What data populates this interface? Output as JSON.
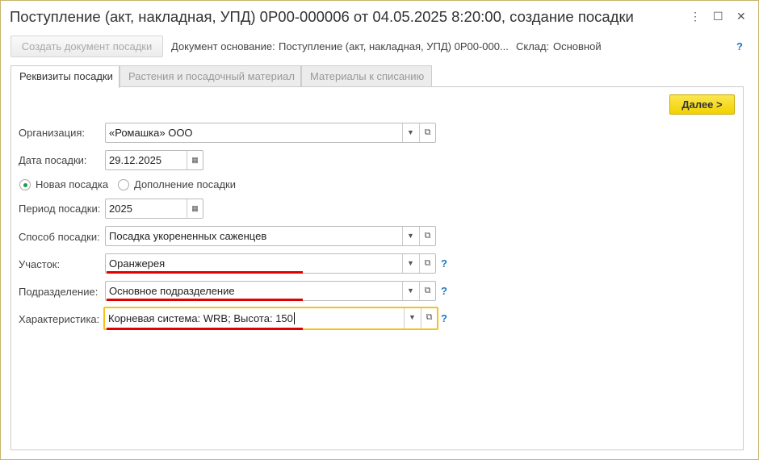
{
  "window": {
    "title": "Поступление (акт, накладная, УПД) 0Р00-000006 от 04.05.2025 8:20:00, создание посадки"
  },
  "toolbar": {
    "create_button": "Создать документ посадки",
    "basis_label": "Документ основание:",
    "basis_value": "Поступление (акт, накладная, УПД) 0Р00-000...",
    "warehouse_label": "Склад:",
    "warehouse_value": "Основной",
    "help": "?"
  },
  "tabs": [
    {
      "label": "Реквизиты посадки",
      "active": true
    },
    {
      "label": "Растения и посадочный материал"
    },
    {
      "label": "Материалы к списанию"
    }
  ],
  "next_button": "Далее >",
  "form": {
    "organization": {
      "label": "Организация:",
      "value": "«Ромашка» ООО"
    },
    "date": {
      "label": "Дата посадки:",
      "value": "29.12.2025"
    },
    "radio": {
      "new": "Новая посадка",
      "addition": "Дополнение посадки",
      "selected": "new"
    },
    "period": {
      "label": "Период посадки:",
      "value": "2025"
    },
    "method": {
      "label": "Способ посадки:",
      "value": "Посадка укорененных саженцев"
    },
    "plot": {
      "label": "Участок:",
      "value": "Оранжерея"
    },
    "division": {
      "label": "Подразделение:",
      "value": "Основное подразделение"
    },
    "characteristic": {
      "label": "Характеристика:",
      "value": "Корневая система: WRB; Высота: 150"
    },
    "help": "?"
  }
}
